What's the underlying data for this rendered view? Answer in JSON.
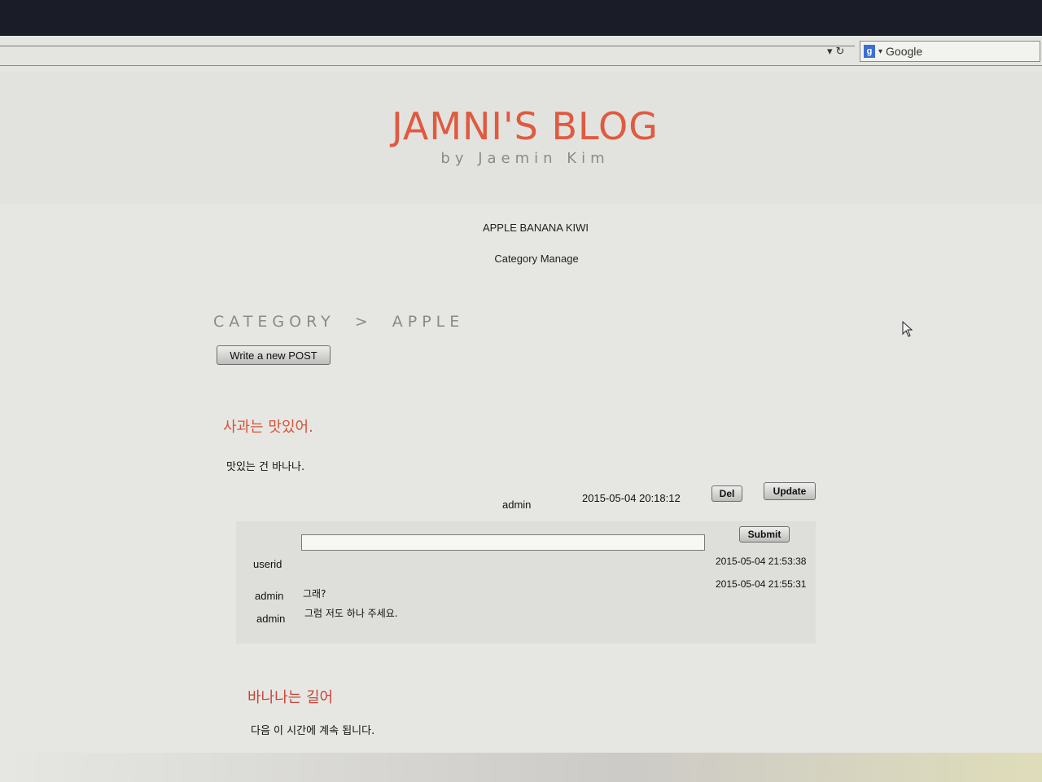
{
  "browser": {
    "search_placeholder": "Google",
    "search_engine_icon": "google-icon",
    "reload_icon": "reload-icon"
  },
  "blog": {
    "title": "JAMNI'S BLOG",
    "subtitle": "by Jaemin Kim",
    "title_color": "#e05a40"
  },
  "nav": {
    "categories": "APPLE BANANA KIWI",
    "manage": "Category Manage"
  },
  "breadcrumb": "CATEGORY  >  APPLE",
  "write_button": "Write a new POST",
  "posts": [
    {
      "title": "사과는 맛있어.",
      "body": "맛있는 건 바나나.",
      "author": "admin",
      "timestamp": "2015-05-04 20:18:12",
      "del_label": "Del",
      "update_label": "Update"
    },
    {
      "title": "바나나는 길어",
      "body": "다음 이 시간에 계속 됩니다."
    }
  ],
  "comment_form": {
    "userid_label": "userid",
    "userid_value": "",
    "submit_label": "Submit"
  },
  "comments": [
    {
      "user": "admin",
      "text": "그래?",
      "timestamp": "2015-05-04 21:53:38"
    },
    {
      "user": "admin",
      "text": "그럼 저도 하나 주세요.",
      "timestamp": "2015-05-04 21:55:31"
    }
  ]
}
